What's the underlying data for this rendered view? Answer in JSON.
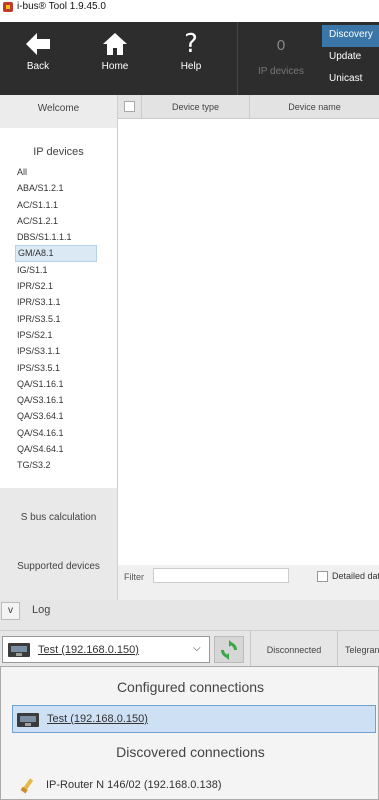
{
  "window": {
    "title": "i-bus® Tool 1.9.45.0"
  },
  "toolbar": {
    "back": "Back",
    "home": "Home",
    "help": "Help",
    "ip_count": "0",
    "ip_devices_label": "IP devices",
    "menu": [
      "Discovery",
      "Update",
      "Unicast"
    ]
  },
  "sidebar": {
    "welcome": "Welcome",
    "ip_devices_header": "IP devices",
    "devices": [
      "All",
      "ABA/S1.2.1",
      "AC/S1.1.1",
      "AC/S1.2.1",
      "DBS/S1.1.1.1",
      "GM/A8.1",
      "IG/S1.1",
      "IPR/S2.1",
      "IPR/S3.1.1",
      "IPR/S3.5.1",
      "IPS/S2.1",
      "IPS/S3.1.1",
      "IPS/S3.5.1",
      "QA/S1.16.1",
      "QA/S3.16.1",
      "QA/S3.64.1",
      "QA/S4.16.1",
      "QA/S4.64.1",
      "TG/S3.2"
    ],
    "selected_device": "GM/A8.1",
    "sbus": "S bus calculation",
    "supported": "Supported devices"
  },
  "table": {
    "col_type": "Device type",
    "col_name": "Device name"
  },
  "filter": {
    "label": "Filter",
    "value": "",
    "detailed_label": "Detailed dat"
  },
  "log": {
    "toggle": "v",
    "label": "Log"
  },
  "connection": {
    "selected": "Test (192.168.0.150)",
    "status": "Disconnected",
    "telegram": "Telegran"
  },
  "popup": {
    "configured_header": "Configured connections",
    "configured": [
      "Test (192.168.0.150)"
    ],
    "discovered_header": "Discovered connections",
    "discovered": [
      "IP-Router N 146/02 (192.168.0.138)"
    ]
  },
  "colors": {
    "toolbar_bg": "#2d2d2d",
    "accent": "#3a76a8",
    "selection": "#cde0f4",
    "refresh_green": "#3aa64a"
  }
}
